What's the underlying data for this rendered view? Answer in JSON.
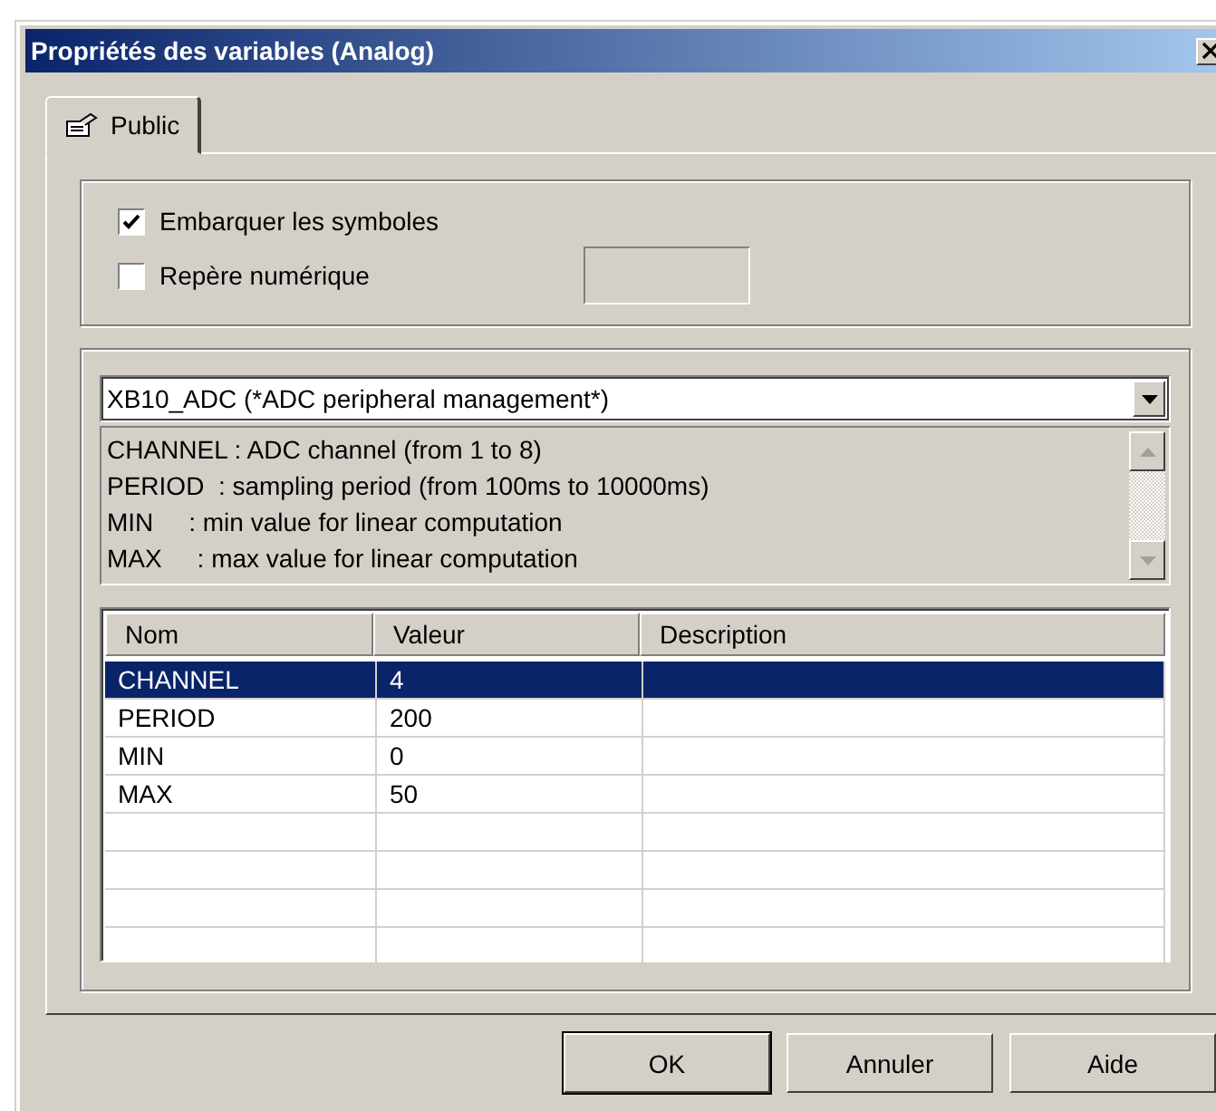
{
  "window": {
    "title": "Propriétés des variables (Analog)"
  },
  "tabs": [
    {
      "label": "Public",
      "selected": true
    }
  ],
  "options": [
    {
      "label": "Embarquer les symboles",
      "checked": true
    },
    {
      "label": "Repère numérique",
      "checked": false
    }
  ],
  "block": {
    "selected": "XB10_ADC (*ADC peripheral management*)",
    "description": [
      "CHANNEL : ADC channel (from 1 to 8)",
      "PERIOD  : sampling period (from 100ms to 10000ms)",
      "MIN     : min value for linear computation",
      "MAX     : max value for linear computation"
    ]
  },
  "table": {
    "columns": [
      "Nom",
      "Valeur",
      "Description"
    ],
    "rows": [
      {
        "cells": [
          "CHANNEL",
          "4",
          ""
        ],
        "selected": true
      },
      {
        "cells": [
          "PERIOD",
          "200",
          ""
        ],
        "selected": false
      },
      {
        "cells": [
          "MIN",
          "0",
          ""
        ],
        "selected": false
      },
      {
        "cells": [
          "MAX",
          "50",
          ""
        ],
        "selected": false
      }
    ]
  },
  "buttons": [
    {
      "label": "OK",
      "default": true
    },
    {
      "label": "Annuler",
      "default": false
    },
    {
      "label": "Aide",
      "default": false
    }
  ]
}
